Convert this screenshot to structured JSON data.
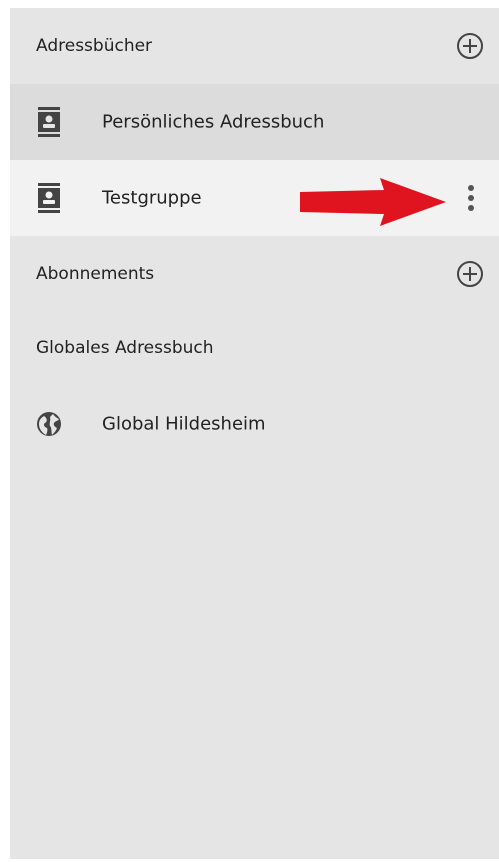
{
  "sidebar": {
    "address_books": {
      "header": "Adressbücher",
      "items": [
        {
          "label": "Persönliches Adressbuch",
          "icon": "contact-book-icon"
        },
        {
          "label": "Testgruppe",
          "icon": "contact-book-icon"
        }
      ]
    },
    "subscriptions": {
      "header": "Abonnements"
    },
    "global": {
      "header": "Globales Adressbuch",
      "items": [
        {
          "label": "Global Hildesheim",
          "icon": "globe-icon"
        }
      ]
    }
  },
  "colors": {
    "panel_bg": "#e5e5e5",
    "hover_row_bg": "#f2f2f2",
    "selected_row_bg": "#dcdcdc",
    "icon_color": "#444444",
    "annotation_arrow": "#e0141e"
  }
}
